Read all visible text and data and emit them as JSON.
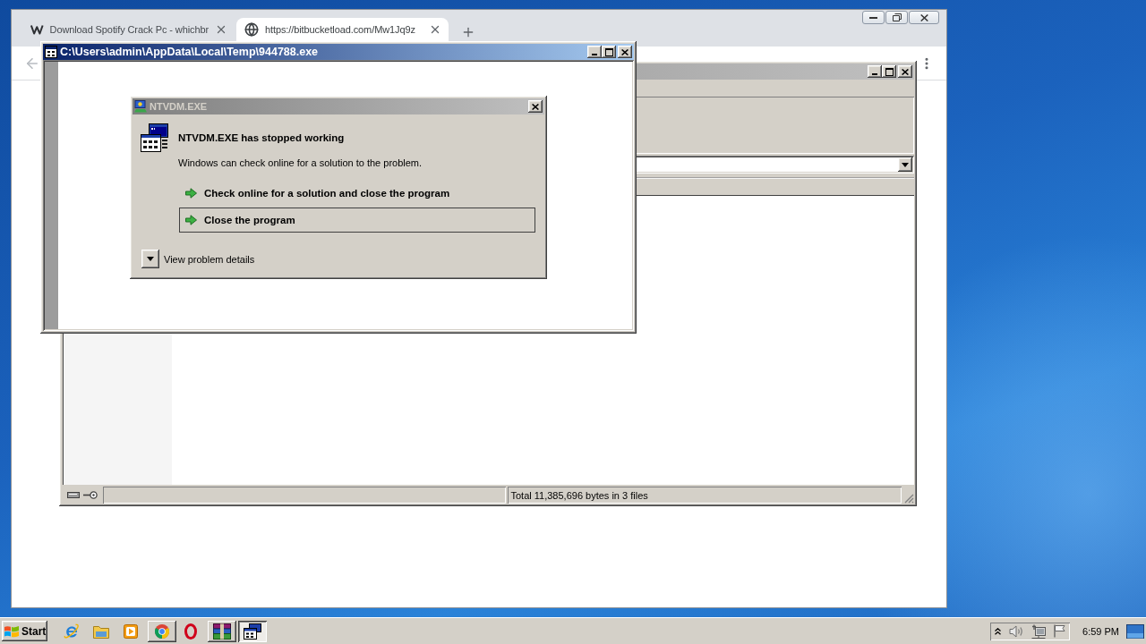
{
  "browser": {
    "tabs": [
      {
        "title": "Download Spotify Crack Pc - whichbr",
        "selected": false
      },
      {
        "title": "https://bitbucketload.com/Mw1Jq9z",
        "selected": true
      }
    ]
  },
  "file_window": {
    "active": false,
    "status_text": "Total 11,385,696 bytes in 3 files"
  },
  "console_window": {
    "active": true,
    "title": "C:\\Users\\admin\\AppData\\Local\\Temp\\944788.exe"
  },
  "error_dialog": {
    "active": false,
    "title": "NTVDM.EXE",
    "heading": "NTVDM.EXE has stopped working",
    "message": "Windows can check online for a solution to the problem.",
    "options": [
      {
        "label": "Check online for a solution and close the program",
        "selected": false
      },
      {
        "label": "Close the program",
        "selected": true
      }
    ],
    "details_toggle": {
      "label": "View problem details",
      "expanded": false
    }
  },
  "taskbar": {
    "start_label": "Start",
    "items": [
      {
        "kind": "launcher"
      },
      {
        "kind": "launcher"
      },
      {
        "kind": "launcher"
      },
      {
        "kind": "task",
        "active": false
      },
      {
        "kind": "launcher"
      },
      {
        "kind": "task",
        "active": false
      },
      {
        "kind": "task",
        "active": true
      }
    ],
    "clock": "6:59 PM"
  }
}
